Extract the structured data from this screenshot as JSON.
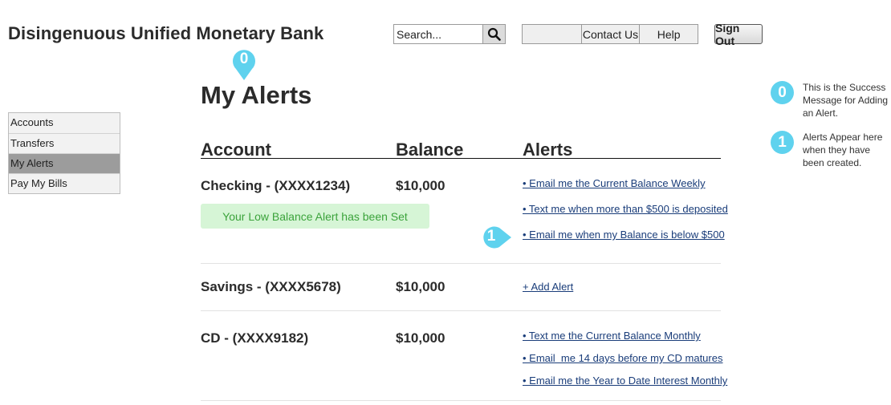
{
  "app": {
    "brand": "Disingenuous Unified Monetary Bank"
  },
  "search": {
    "placeholder": "Search..."
  },
  "topnav": {
    "items": [
      "Contact Us",
      "Help"
    ]
  },
  "signout_label": "Sign Out",
  "sidebar": {
    "items": [
      {
        "label": "Accounts"
      },
      {
        "label": "Transfers"
      },
      {
        "label": "My Alerts",
        "active": true
      },
      {
        "label": "Pay My Bills"
      }
    ]
  },
  "main": {
    "title": "My Alerts",
    "columns": {
      "account": "Account",
      "balance": "Balance",
      "alerts": "Alerts"
    },
    "rows": [
      {
        "account": "Checking - (XXXX1234)",
        "balance": "$10,000",
        "alerts": [
          "• Email me the Current Balance Weekly",
          "• Text me when more than $500 is deposited",
          "• Email me when my Balance is below $500"
        ]
      },
      {
        "account": "Savings - (XXXX5678)",
        "balance": "$10,000",
        "alerts": [
          "+ Add Alert"
        ]
      },
      {
        "account": "CD - (XXXX9182)",
        "balance": "$10,000",
        "alerts": [
          "• Text me the Current Balance Monthly",
          "• Email  me 14 days before my CD matures",
          "• Email me the Year to Date Interest Monthly"
        ]
      }
    ],
    "success_message": "Your Low Balance Alert has been Set"
  },
  "annotations": [
    {
      "num": "0",
      "text": "This is the Success Message for Adding an Alert."
    },
    {
      "num": "1",
      "text": "Alerts Appear here when they have been created."
    }
  ],
  "colors": {
    "annotation": "#5fd2ee",
    "success_bg": "#d6f5d6",
    "success_text": "#3ba33b",
    "link": "#1a3d7a",
    "active_nav": "#9c9c9c"
  }
}
